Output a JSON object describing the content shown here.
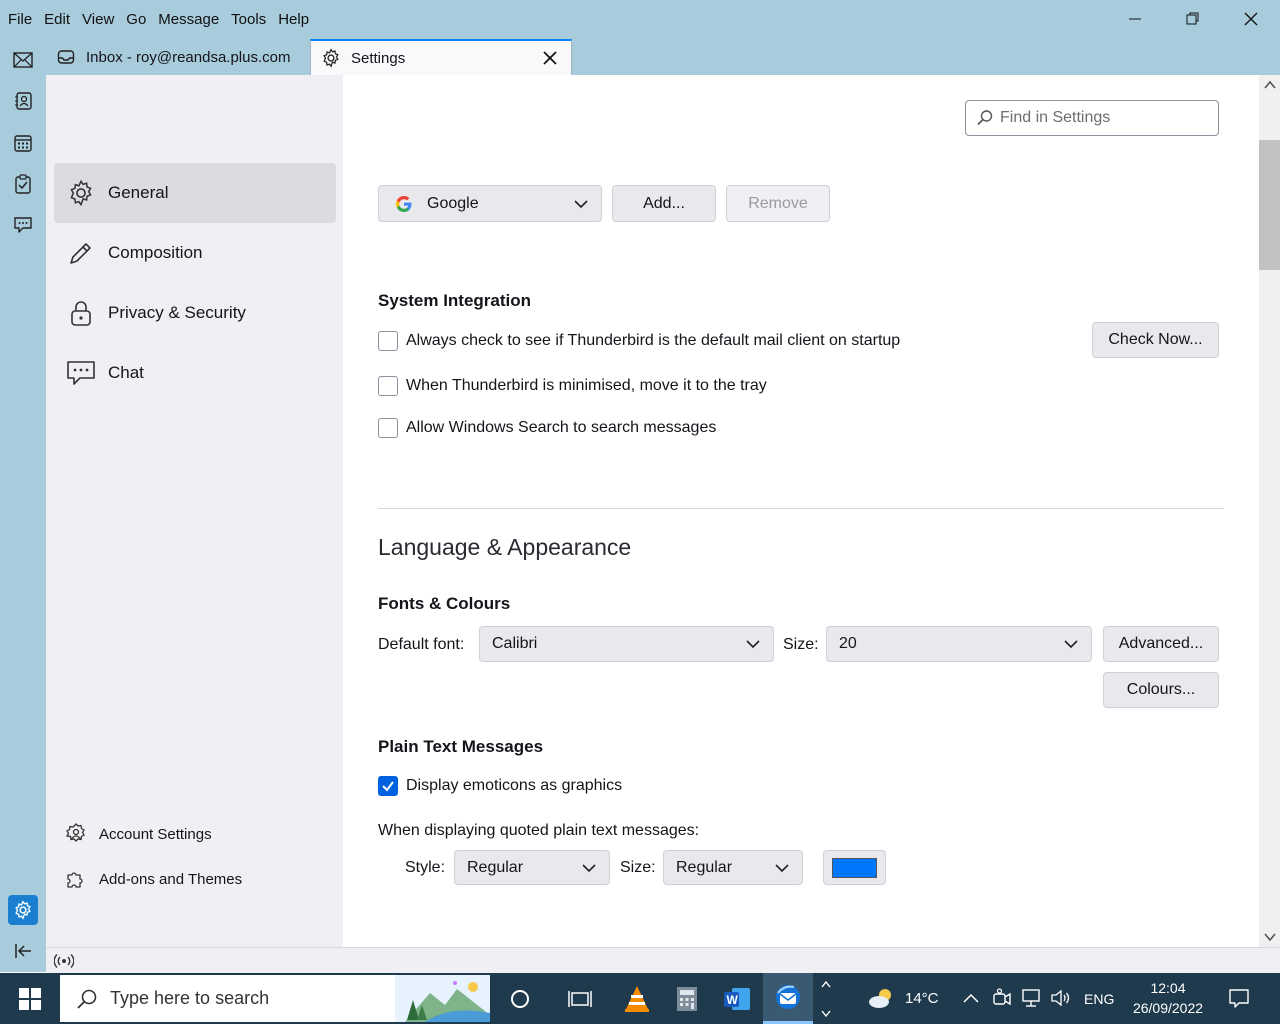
{
  "menu": [
    {
      "label": "File"
    },
    {
      "label": "Edit"
    },
    {
      "label": "View"
    },
    {
      "label": "Go"
    },
    {
      "label": "Message"
    },
    {
      "label": "Tools"
    },
    {
      "label": "Help"
    }
  ],
  "tabs": {
    "inbox": "Inbox - roy@reandsa.plus.com",
    "settings": "Settings"
  },
  "sidebar": {
    "categories": [
      {
        "label": "General"
      },
      {
        "label": "Composition"
      },
      {
        "label": "Privacy & Security"
      },
      {
        "label": "Chat"
      }
    ],
    "account_settings": "Account Settings",
    "addons_themes": "Add-ons and Themes"
  },
  "search": {
    "placeholder": "Find in Settings"
  },
  "search_engine": {
    "selected": "Google",
    "add_label": "Add...",
    "remove_label": "Remove"
  },
  "system_integration": {
    "title": "System Integration",
    "check_now": "Check Now...",
    "options": [
      {
        "label": "Always check to see if Thunderbird is the default mail client on startup",
        "checked": false
      },
      {
        "label": "When Thunderbird is minimised, move it to the tray",
        "checked": false
      },
      {
        "label": "Allow Windows Search to search messages",
        "checked": false
      }
    ]
  },
  "language_appearance": {
    "title": "Language & Appearance",
    "fonts_title": "Fonts & Colours",
    "default_font_label": "Default font:",
    "default_font": "Calibri",
    "size_label": "Size:",
    "size": "20",
    "advanced_label": "Advanced...",
    "colours_label": "Colours..."
  },
  "plain_text": {
    "title": "Plain Text Messages",
    "emoticons_label": "Display emoticons as graphics",
    "emoticons_checked": true,
    "quoted_label": "When displaying quoted plain text messages:",
    "style_label": "Style:",
    "style_value": "Regular",
    "size_label": "Size:",
    "size_value": "Regular",
    "quote_color": "#0077ff"
  },
  "taskbar": {
    "search_placeholder": "Type here to search",
    "temperature": "14°C",
    "language": "ENG",
    "time": "12:04",
    "date": "26/09/2022"
  }
}
